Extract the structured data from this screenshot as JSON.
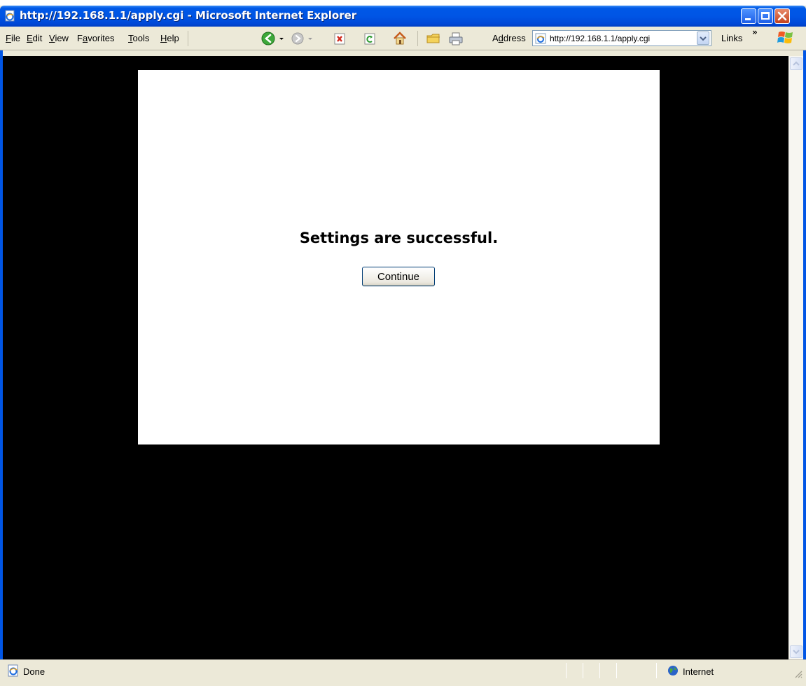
{
  "window": {
    "title": "http://192.168.1.1/apply.cgi - Microsoft Internet Explorer"
  },
  "menu": {
    "file": "ile",
    "file_key": "F",
    "edit": "dit",
    "edit_key": "E",
    "view": "iew",
    "view_key": "V",
    "favorites_pre": "F",
    "favorites_key": "a",
    "favorites_post": "vorites",
    "tools": "ools",
    "tools_key": "T",
    "help": "elp",
    "help_key": "H"
  },
  "toolbar": {
    "icons": [
      "back-icon",
      "forward-icon",
      "stop-icon",
      "refresh-icon",
      "home-icon",
      "folder-icon",
      "print-icon"
    ]
  },
  "address": {
    "label_pre": "A",
    "label_key": "d",
    "label_post": "dress",
    "url": "http://192.168.1.1/apply.cgi"
  },
  "links": {
    "label": "Links",
    "chevron": "»"
  },
  "page": {
    "message": "Settings are successful.",
    "continue_label": "Continue"
  },
  "status": {
    "text": "Done",
    "zone": "Internet"
  },
  "colors": {
    "titlebar": "#0055e5",
    "content_background": "#000000",
    "panel": "#ffffff",
    "chrome": "#ece9d8"
  }
}
